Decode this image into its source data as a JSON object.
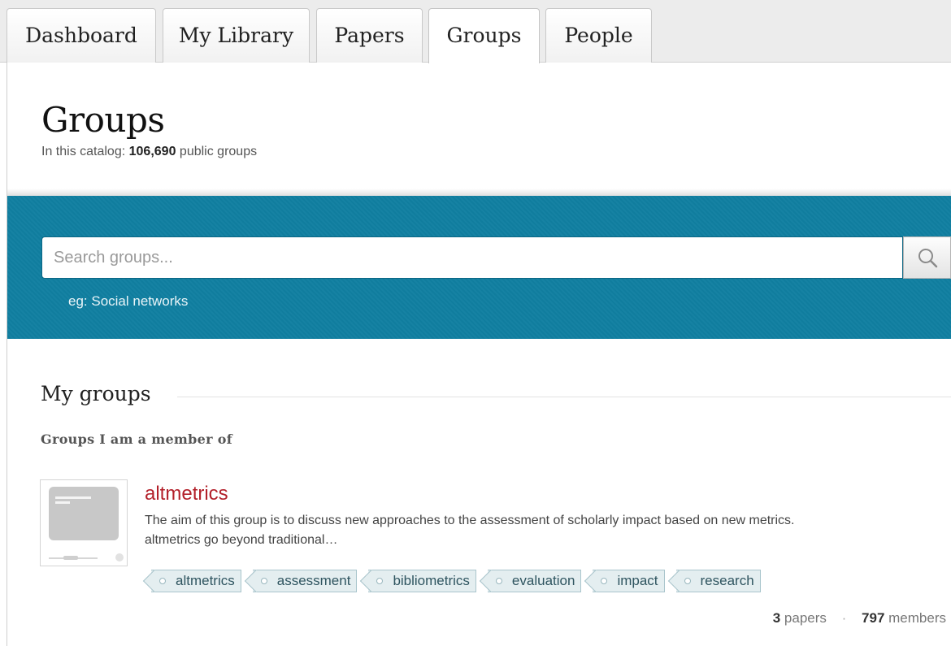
{
  "tabs": [
    {
      "label": "Dashboard",
      "active": false
    },
    {
      "label": "My Library",
      "active": false
    },
    {
      "label": "Papers",
      "active": false
    },
    {
      "label": "Groups",
      "active": true
    },
    {
      "label": "People",
      "active": false
    }
  ],
  "header": {
    "title": "Groups",
    "catalog_prefix": "In this catalog:",
    "catalog_count": "106,690",
    "catalog_suffix": "public groups"
  },
  "search": {
    "placeholder": "Search groups...",
    "value": "",
    "hint": "eg: Social networks",
    "icon": "search-icon"
  },
  "my_groups": {
    "title": "My groups",
    "subtitle": "Groups I am a member of",
    "groups": [
      {
        "name": "altmetrics",
        "description": "The aim of this group is to discuss new approaches to the assessment of scholarly impact based on new metrics. altmetrics go beyond traditional…",
        "tags": [
          "altmetrics",
          "assessment",
          "bibliometrics",
          "evaluation",
          "impact",
          "research"
        ],
        "papers_count": "3",
        "papers_label": "papers",
        "members_count": "797",
        "members_label": "members",
        "separator": "·"
      }
    ]
  },
  "colors": {
    "search_band": "#107fa1",
    "group_link": "#b3202a",
    "tag_bg": "#e4eef0"
  }
}
